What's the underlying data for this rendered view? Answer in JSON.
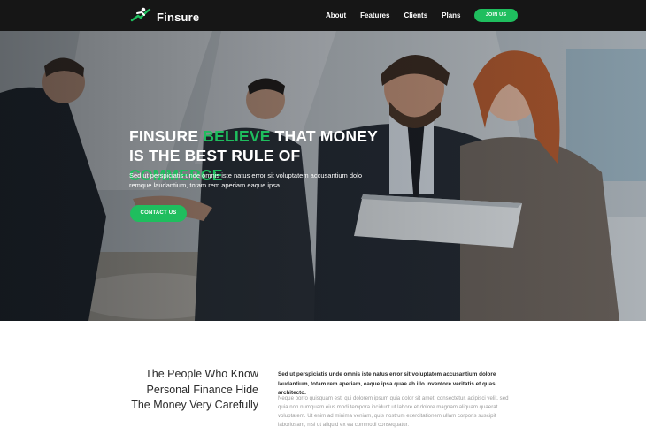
{
  "brand": {
    "name": "Finsure",
    "accent": "#1fbe5e",
    "dark": "#161616"
  },
  "nav": {
    "items": [
      {
        "label": "About"
      },
      {
        "label": "Features"
      },
      {
        "label": "Clients"
      },
      {
        "label": "Plans"
      }
    ],
    "cta_label": "JOIN US"
  },
  "hero": {
    "title_line1_a": "FINSURE ",
    "title_line1_accent": "BELIEVE",
    "title_line1_b": " THAT MONEY",
    "title_line2_a": "IS THE BEST RULE OF ",
    "title_line2_accent": "COMMERCE",
    "subtitle": "Sed ut perspiciatis unde omnis iste natus error sit voluptatem accusantium dolo remque laudantium, totam rem aperiam eaque ipsa.",
    "cta_label": "CONTACT US"
  },
  "about": {
    "heading": "The People Who Know Personal Finance Hide The Money Very Carefully",
    "lead": "Sed ut perspiciatis unde omnis iste natus error sit voluptatem accusantium dolore laudantium, totam rem aperiam, eaque ipsa quae ab illo inventore veritatis et quasi architecto.",
    "body": "Neque porro quisquam est, qui dolorem ipsum quia dolor sit amet, consectetur, adipisci velit, sed quia non numquam eius modi tempora incidunt ut labore et dolore magnam aliquam quaerat voluptatem. Ut enim ad minima veniam, quis nostrum exercitationem ullam corporis suscipit laboriosam, nisi ut aliquid ex ea commodi consequatur."
  }
}
